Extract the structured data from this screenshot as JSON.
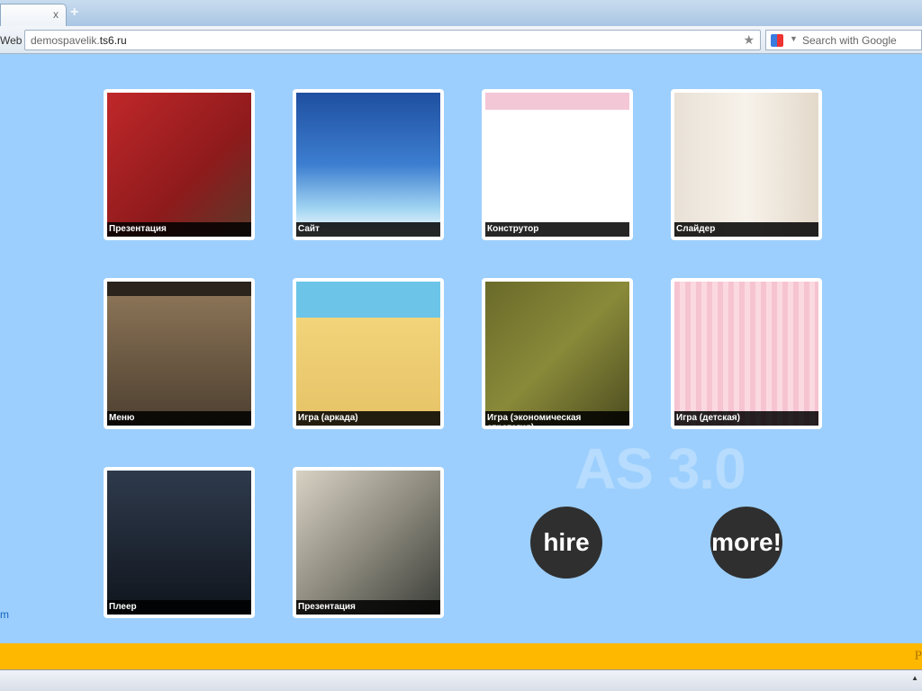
{
  "browser": {
    "tab_close": "x",
    "new_tab": "+",
    "web_label": "Web",
    "url_domain": "demospavelik.",
    "url_host": "ts6.ru",
    "search_placeholder": "Search with Google"
  },
  "thumbs": [
    {
      "caption": "Презентация",
      "bg": "linear-gradient(135deg,#c0282a,#8e1a1c 60%,#5a3a2a)"
    },
    {
      "caption": "Сайт",
      "bg": "linear-gradient(#1f4fa0,#3d7ed0 50%,#9fd3f2 80%,#ffffff)"
    },
    {
      "caption": "Конструтор",
      "bg": "linear-gradient(#f3c7d6 0 12%,#ffffff 12%)"
    },
    {
      "caption": "Слайдер",
      "bg": "linear-gradient(90deg,#e9e1d6,#f7f2ea,#e3d9cb)"
    },
    {
      "caption": "Меню",
      "bg": "linear-gradient(#2a241c 0 10%,#8a7356 10%,#4d3f30)"
    },
    {
      "caption": "Игра (аркада)",
      "bg": "linear-gradient(#6cc5e8 0 25%,#f2d47a 25%,#e6c266)"
    },
    {
      "caption": "Игра (экономическая стратегия)",
      "bg": "linear-gradient(135deg,#6a6a2a,#8a8a3a,#4d4d20)"
    },
    {
      "caption": "Игра (детская)",
      "bg": "repeating-linear-gradient(90deg,#f6c4d0 0 6px,#fbd9e1 6px 12px)"
    },
    {
      "caption": "Плеер",
      "bg": "linear-gradient(#2e3a4c,#1c2430 60%,#10151c)"
    },
    {
      "caption": "Презентация",
      "bg": "linear-gradient(135deg,#d8d2c4,#8d8a7e 50%,#3a3d38)"
    }
  ],
  "banner": "AS 3.0",
  "hire_label": "hire",
  "more_label": "more!",
  "side_link": "m",
  "footer_text": "P",
  "colors": {
    "page_bg": "#9ccffd",
    "footer": "#ffb800",
    "button": "#2f2f2f"
  }
}
